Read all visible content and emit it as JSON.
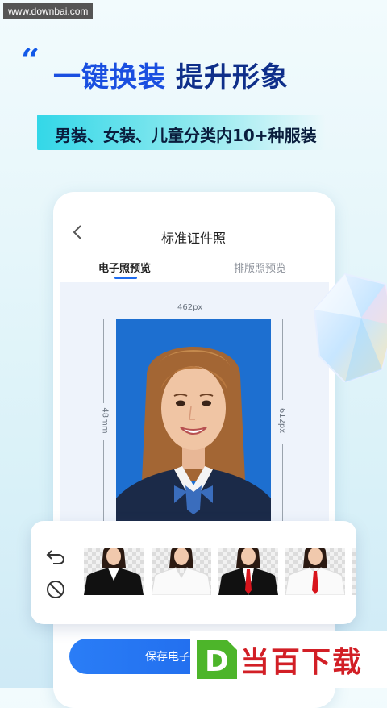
{
  "watermark": {
    "site": "www.downbai.com"
  },
  "hero": {
    "quote_mark": "“",
    "headline_part1": "一键换装",
    "headline_part2": "提升形象",
    "subtitle": "男装、女装、儿童分类内10+种服装"
  },
  "app": {
    "title": "标准证件照",
    "tabs": [
      {
        "label": "电子照预览",
        "active": true
      },
      {
        "label": "排版照预览",
        "active": false
      }
    ],
    "dimensions": {
      "width_label": "462px",
      "height_px_label": "612px",
      "height_mm_label": "48mm"
    },
    "photo_background_color": "#1d6fd0",
    "outfit_panel": {
      "undo_icon": "undo-icon",
      "none_icon": "no-outfit-icon",
      "outfits": [
        {
          "name": "black-suit-white-shirt"
        },
        {
          "name": "white-shirt"
        },
        {
          "name": "black-suit-red-tie"
        },
        {
          "name": "white-shirt-red-tie"
        }
      ]
    },
    "save_button": {
      "label": "保存电子"
    }
  },
  "bottom_logo": {
    "letter": "D",
    "text": "当百下载"
  },
  "colors": {
    "accent": "#1e6cf0",
    "headline": "#1a4fe0",
    "subbar": "#33d7e8",
    "logo_red": "#d21f26"
  }
}
